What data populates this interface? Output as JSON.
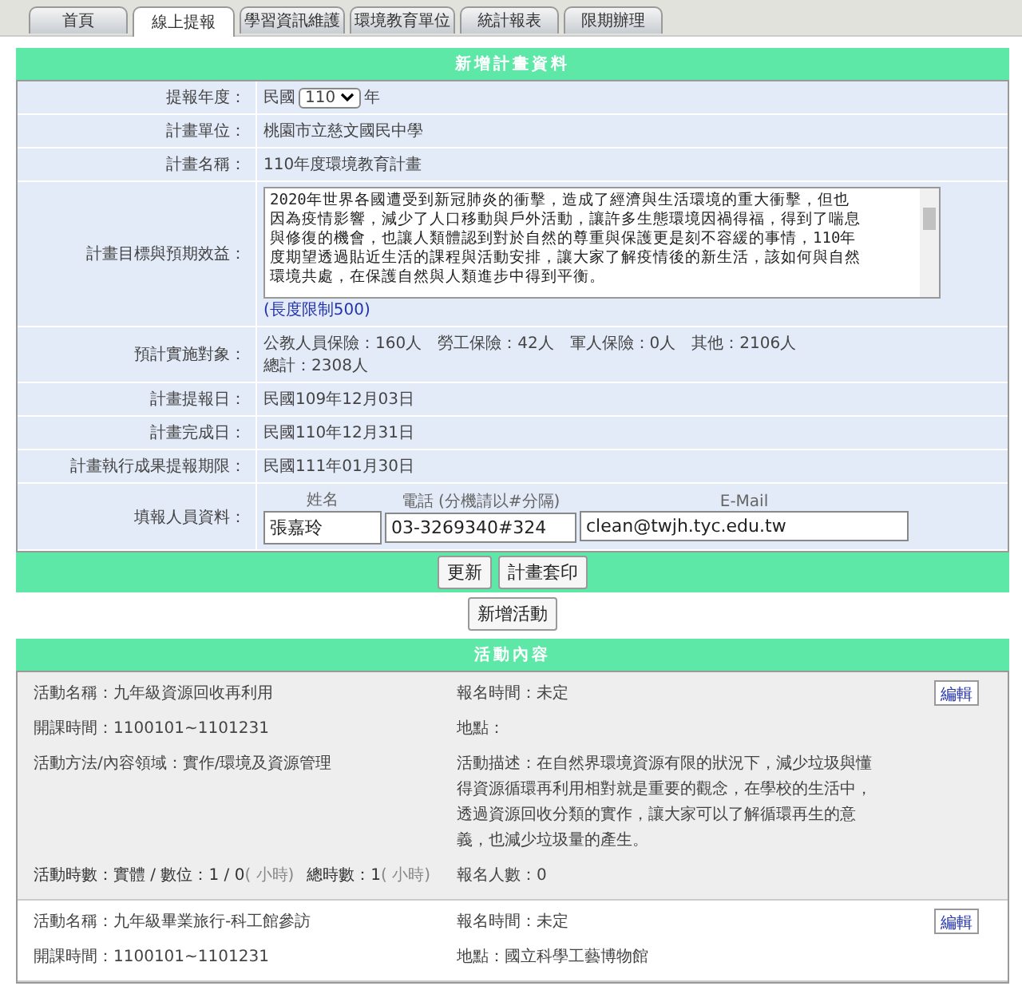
{
  "tabs": [
    {
      "label": "首頁",
      "selected": false
    },
    {
      "label": "線上提報",
      "selected": true
    },
    {
      "label": "學習資訊維護",
      "selected": false
    },
    {
      "label": "環境教育單位",
      "selected": false
    },
    {
      "label": "統計報表",
      "selected": false
    },
    {
      "label": "限期辦理",
      "selected": false
    }
  ],
  "form": {
    "title": "新增計畫資料",
    "year": {
      "label": "提報年度：",
      "prefix": "民國",
      "value": "110",
      "suffix": "年"
    },
    "rows": [
      {
        "label": "計畫單位：",
        "value": "桃園市立慈文國民中學"
      },
      {
        "label": "計畫名稱：",
        "value": "110年度環境教育計畫"
      }
    ],
    "objective": {
      "label": "計畫目標與預期效益：",
      "lines": [
        "2020年世界各國遭受到新冠肺炎的衝擊，造成了經濟與生活環境的重大衝擊，但也",
        "因為疫情影響，減少了人口移動與戶外活動，讓許多生態環境因禍得福，得到了喘息",
        "與修復的機會，也讓人類體認到對於自然的尊重與保護更是刻不容緩的事情，110年",
        "度期望透過貼近生活的課程與活動安排，讓大家了解疫情後的新生活，該如何與自然",
        "環境共處，在保護自然與人類進步中得到平衡。"
      ],
      "limit": "(長度限制500)"
    },
    "target": {
      "label": "預計實施對象：",
      "lines": [
        "公教人員保險：160人　勞工保險：42人　軍人保險：0人　其他：2106人",
        "總計：2308人"
      ]
    },
    "dates": [
      {
        "label": "計畫提報日：",
        "value": "民國109年12月03日"
      },
      {
        "label": "計畫完成日：",
        "value": "民國110年12月31日"
      },
      {
        "label": "計畫執行成果提報期限：",
        "value": "民國111年01月30日"
      }
    ],
    "reporter": {
      "label": "填報人員資料：",
      "fields": [
        {
          "caption": "姓名",
          "value": "張嘉玲"
        },
        {
          "caption": "電話 (分機請以#分隔)",
          "value": "03-3269340#324"
        },
        {
          "caption": "E-Mail",
          "value": "clean@twjh.tyc.edu.tw"
        }
      ]
    },
    "buttons": [
      "更新",
      "計畫套印"
    ]
  },
  "add_button": "新增活動",
  "activities": {
    "title": "活動內容",
    "items": [
      {
        "edit": "編輯",
        "fields": [
          {
            "label": "活動名稱：",
            "value": "九年級資源回收再利用"
          },
          {
            "label": "報名時間：",
            "value": "未定"
          },
          {
            "label": "開課時間：",
            "value": "1100101~1101231"
          },
          {
            "label": "地點："
          },
          {
            "label": "活動方法/內容領域：",
            "value": "實作/環境及資源管理"
          },
          {
            "label": "活動描述：",
            "value": "在自然界環境資源有限的狀況下，減少垃圾與懂得資源循環再利用相對就是重要的觀念，在學校的生活中，透過資源回收分類的實作，讓大家可以了解循環再生的意義，也減少垃圾量的產生。"
          }
        ],
        "hours": [
          {
            "kind": "value",
            "text": "活動時數：實體 / 數位：1 / 0"
          },
          {
            "kind": "unit",
            "text": "( 小時)"
          },
          {
            "kind": "value",
            "text": "總時數：1"
          },
          {
            "kind": "unit",
            "text": "( 小時)"
          }
        ],
        "signups": {
          "label": "報名人數：",
          "value": "0"
        }
      },
      {
        "edit": "編輯",
        "fields": [
          {
            "label": "活動名稱：",
            "value": "九年級畢業旅行-科工館參訪"
          },
          {
            "label": "報名時間：",
            "value": "未定"
          },
          {
            "label": "開課時間：",
            "value": "1100101~1101231"
          },
          {
            "label": "地點：",
            "value": "國立科學工藝博物館"
          }
        ]
      }
    ]
  }
}
